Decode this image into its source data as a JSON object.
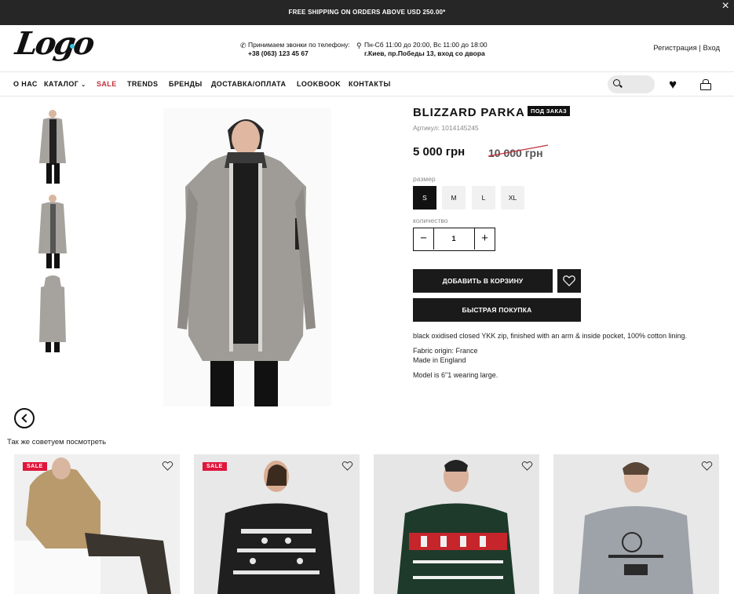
{
  "announcement": "FREE SHIPPING ON ORDERS ABOVE USD 250.00*",
  "logo_text": "Logo",
  "contacts": {
    "phone_label": "Принимаем звонки по телефону:",
    "phone": "+38 (063) 123 45 67",
    "hours": "Пн-Сб 11:00 до 20:00, Вс 11:00 до 18:00",
    "address": "г.Киев, пр.Победы 13, вход со двора"
  },
  "auth": {
    "register": "Регистрация",
    "separator": "|",
    "login": "Вход"
  },
  "nav": {
    "about": "О НАС",
    "catalog": "КАТАЛОГ",
    "sale": "SALE",
    "trends": "TRENDS",
    "brands": "БРЕНДЫ",
    "delivery": "ДОСТАВКА/ОПЛАТА",
    "lookbook": "LOOKBOOK",
    "contacts": "КОНТАКТЫ"
  },
  "product": {
    "title": "BLIZZARD PARKA",
    "badge": "ПОД ЗАКАЗ",
    "sku": "Артикул: 1014145245",
    "price": "5 000 грн",
    "old_price": "10 000 грн",
    "size_label": "размер",
    "sizes": [
      "S",
      "M",
      "L",
      "XL"
    ],
    "selected_size": "S",
    "quantity_label": "количество",
    "quantity": "1",
    "add_to_cart": "ДОБАВИТЬ В КОРЗИНУ",
    "quick_buy": "БЫСТРАЯ ПОКУПКА",
    "description": "black oxidised closed YKK zip, finished with an arm & inside pocket, 100% cotton lining.",
    "fabric_origin": "Fabric origin: France",
    "made_in": "Made in England",
    "model_info": "Model is 6\"1 wearing large."
  },
  "recommend_title": "Так же советуем посмотреть",
  "cards": [
    {
      "badge": "SALE"
    },
    {
      "badge": "SALE"
    },
    {
      "badge": ""
    },
    {
      "badge": ""
    }
  ],
  "colors": {
    "topbar_bg": "#262626",
    "sale_red": "#c0303a",
    "badge_red": "#e0163c",
    "logo_accent": "#38c8e0",
    "button_black": "#1a1a1a"
  }
}
